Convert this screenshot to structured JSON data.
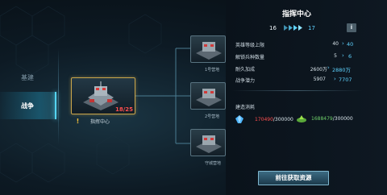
{
  "tabs": {
    "base": "基建",
    "war": "战争"
  },
  "main_building": {
    "name": "指挥中心",
    "level_text": "18/25"
  },
  "children": [
    {
      "name": "1号营地"
    },
    {
      "name": "2号营地"
    },
    {
      "name": "守城营地"
    }
  ],
  "panel": {
    "title": "指挥中心",
    "level_from": "16",
    "level_to": "17",
    "stats": [
      {
        "label": "英雄等级上限",
        "old": "40",
        "new": "40"
      },
      {
        "label": "解锁兵种数量",
        "old": "5",
        "new": "6"
      },
      {
        "label": "耐久加成",
        "old": "2600万",
        "new": "2880万"
      },
      {
        "label": "战争潜力",
        "old": "5907",
        "new": "7707"
      }
    ],
    "cost_label": "建造消耗",
    "resources": [
      {
        "icon": "blue-crystal-icon",
        "have": "170490",
        "need": "/300000"
      },
      {
        "icon": "green-gem-icon",
        "have": "1688479",
        "need": "/300000"
      }
    ],
    "go_button": "前往获取资源"
  },
  "colors": {
    "accent": "#5fd3ff",
    "warning": "#ff4f4f",
    "frame_gold": "#c9a54b"
  }
}
